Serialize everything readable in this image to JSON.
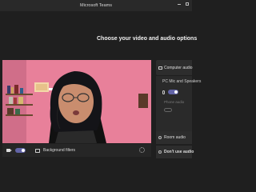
{
  "window": {
    "title": "Microsoft Teams"
  },
  "prejoin": {
    "heading": "Choose your video and audio options"
  },
  "video": {
    "camera_on": true,
    "background_filters_label": "Background filters"
  },
  "audio_options": {
    "computer_audio_label": "Computer audio",
    "pc_mic_speakers_label": "PC Mic and Speakers",
    "mic_on": true,
    "phone_audio_label": "Phone audio",
    "room_audio_label": "Room audio",
    "dont_use_audio_label": "Don't use audio"
  },
  "colors": {
    "accent": "#6264a7",
    "background": "#1f1f1f",
    "wall": "#e8809a"
  }
}
